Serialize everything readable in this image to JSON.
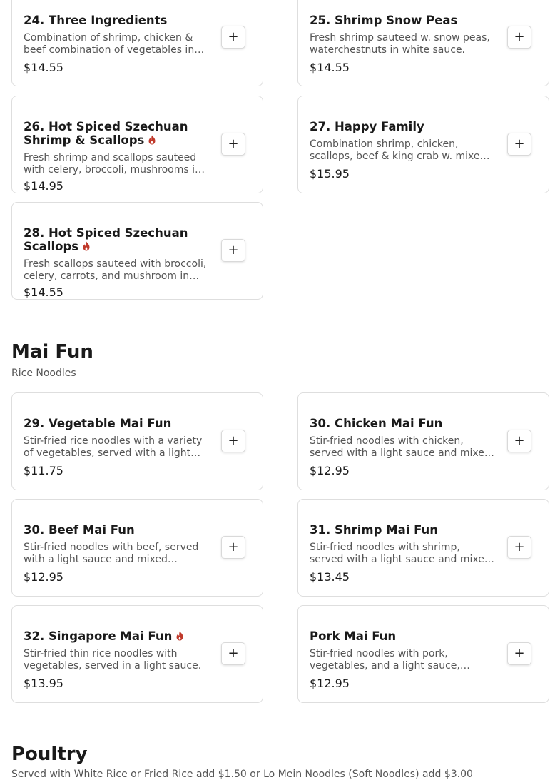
{
  "colors": {
    "spicy_icon": "#c0392b",
    "card_border": "#dedede",
    "muted_text": "#555555"
  },
  "add_button_icon": "plus-icon",
  "add_button_label": "+",
  "sections": [
    {
      "title": "",
      "items": [
        {
          "name": "24. Three Ingredients",
          "desc": "Combination of shrimp, chicken & beef combination of vegetables in brown sauce.",
          "price": "$14.55",
          "spicy": false
        },
        {
          "name": "25. Shrimp Snow Peas",
          "desc": "Fresh shrimp sauteed w. snow peas, waterchestnuts in white sauce.",
          "price": "$14.55",
          "spicy": false
        },
        {
          "name": "26. Hot Spiced Szechuan Shrimp & Scallops",
          "desc": "Fresh shrimp and scallops sauteed with celery, broccoli, mushrooms in hot spicy sauce.",
          "price": "$14.95",
          "spicy": true
        },
        {
          "name": "27. Happy Family",
          "desc": "Combination shrimp, chicken, scallops, beef & king crab w. mixed vegetables.",
          "price": "$15.95",
          "spicy": false
        },
        {
          "name": "28. Hot Spiced Szechuan Scallops",
          "desc": "Fresh scallops sauteed with broccoli, celery, carrots, and mushroom in hot spicy sauce.",
          "price": "$14.55",
          "spicy": true
        }
      ]
    },
    {
      "title": "Mai Fun",
      "subtitle": "Rice Noodles",
      "items": [
        {
          "name": "29. Vegetable Mai Fun",
          "desc": "Stir-fried rice noodles with a variety of vegetables, served with a light sauce.",
          "price": "$11.75",
          "spicy": false
        },
        {
          "name": "30. Chicken Mai Fun",
          "desc": "Stir-fried noodles with chicken, served with a light sauce and mixed vegetables.",
          "price": "$12.95",
          "spicy": false
        },
        {
          "name": "30. Beef Mai Fun",
          "desc": "Stir-fried noodles with beef, served with a light sauce and mixed vegetables.",
          "price": "$12.95",
          "spicy": false
        },
        {
          "name": "31. Shrimp Mai Fun",
          "desc": "Stir-fried noodles with shrimp, served with a light sauce and mixed vegetables.",
          "price": "$13.45",
          "spicy": false
        },
        {
          "name": "32. Singapore Mai Fun",
          "desc": "Stir-fried thin rice noodles with vegetables, served in a light sauce.",
          "price": "$13.95",
          "spicy": true
        },
        {
          "name": "Pork Mai Fun",
          "desc": "Stir-fried noodles with pork, vegetables, and a light sauce, offering a simple and savory taste.",
          "price": "$12.95",
          "spicy": false
        }
      ]
    },
    {
      "title": "Poultry",
      "subtitle": "Served with White Rice or Fried Rice add $1.50 or Lo Mein Noodles (Soft Noodles) add $3.00"
    }
  ]
}
